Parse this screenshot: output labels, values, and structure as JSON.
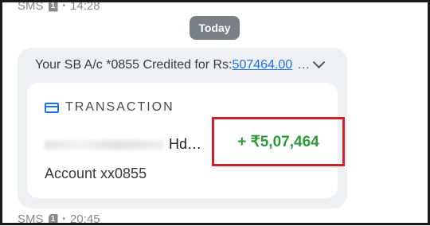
{
  "header_meta": {
    "source": "SMS",
    "sim": "1",
    "time": "14:28"
  },
  "divider": {
    "today_label": "Today"
  },
  "message": {
    "preview_text": "Your SB A/c *0855 Credited for Rs:",
    "preview_amount_link": "507464.00",
    "preview_ellipsis": "…",
    "card": {
      "title": "TRANSACTION",
      "merchant_suffix": "Hd…",
      "account": "Account xx0855",
      "amount": "+ ₹5,07,464"
    }
  },
  "footer_meta": {
    "source": "SMS",
    "sim": "1",
    "time": "20:45"
  },
  "colors": {
    "amount_green": "#2e9b3a",
    "highlight_red": "#d0202a",
    "link_blue": "#1a73e8",
    "pill_gray": "#7a7f86",
    "bubble_bg": "#eef0f3"
  },
  "icons": {
    "transaction": "credit-card-icon",
    "expand": "chevron-down-icon",
    "sim": "sim-card-icon"
  }
}
